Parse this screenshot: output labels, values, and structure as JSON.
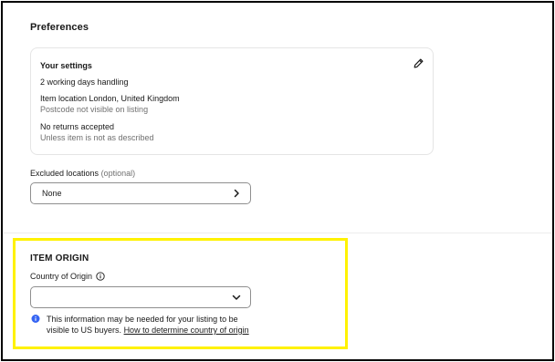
{
  "section_title": "Preferences",
  "settings": {
    "heading": "Your settings",
    "handling": "2 working days handling",
    "location": "Item location London, United Kingdom",
    "postcode_note": "Postcode not visible on listing",
    "returns": "No returns accepted",
    "returns_note": "Unless item is not as described"
  },
  "excluded": {
    "label": "Excluded locations",
    "optional": "(optional)",
    "value": "None"
  },
  "item_origin": {
    "title": "ITEM ORIGIN",
    "country_label": "Country of Origin",
    "country_value": "",
    "notice_text": "This information may be needed for your listing to be visible to US buyers.",
    "notice_link": "How to determine country of origin"
  },
  "icons": {
    "edit": "pencil-icon",
    "chevron_right": "chevron-right-icon",
    "chevron_down": "chevron-down-icon",
    "info_outline": "info-outline-icon",
    "info_filled": "info-filled-icon"
  },
  "colors": {
    "highlight": "#fff200",
    "info_blue": "#3665f3",
    "text": "#191919",
    "muted": "#707070"
  }
}
